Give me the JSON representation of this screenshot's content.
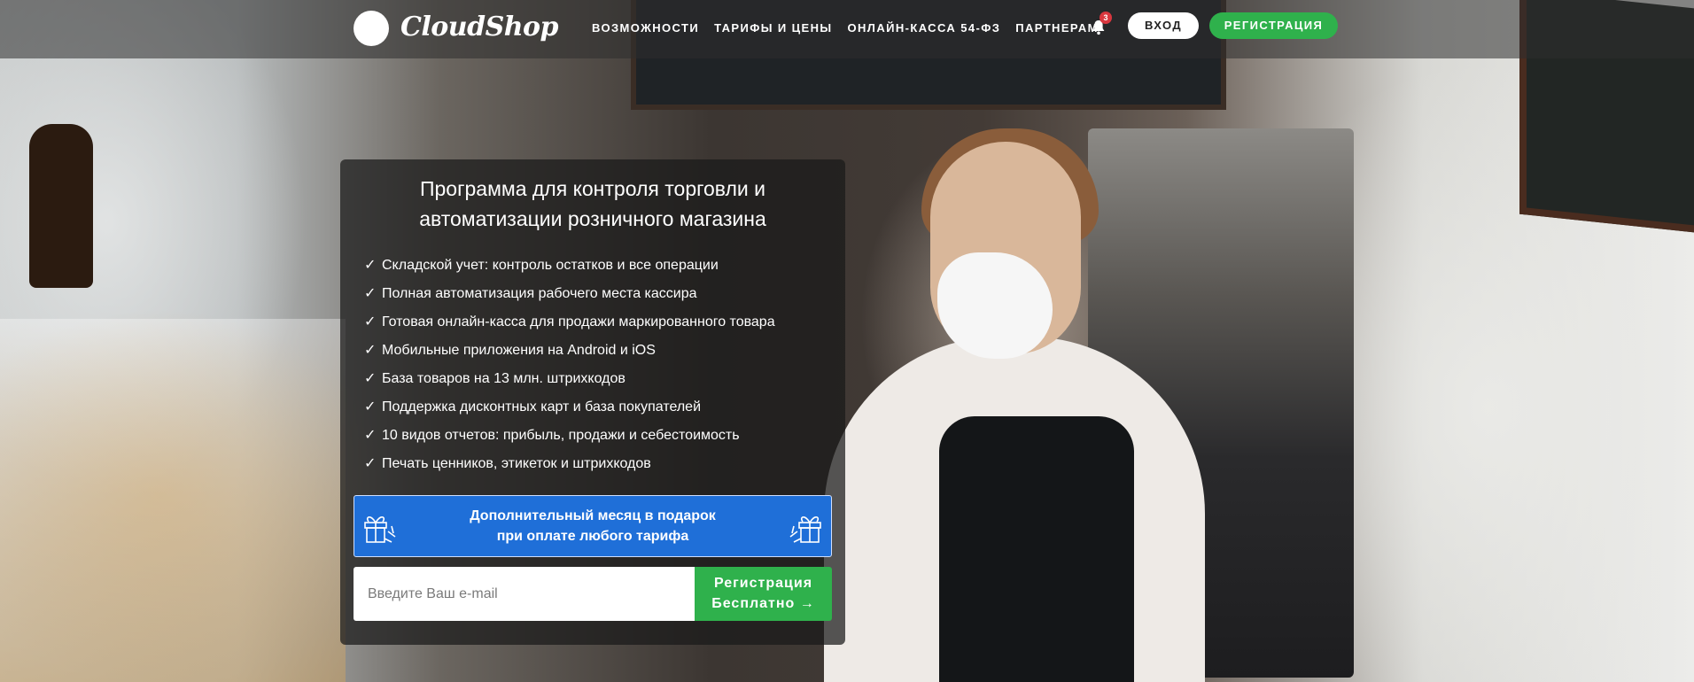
{
  "brand": {
    "name": "CloudShop"
  },
  "nav": {
    "items": [
      {
        "label": "ВОЗМОЖНОСТИ"
      },
      {
        "label": "ТАРИФЫ И ЦЕНЫ"
      },
      {
        "label": "ОНЛАЙН-КАССА 54-ФЗ"
      },
      {
        "label": "ПАРТНЕРАМ"
      }
    ],
    "notifications_count": "3",
    "login_label": "ВХОД",
    "register_label": "РЕГИСТРАЦИЯ"
  },
  "hero": {
    "title_line1": "Программа для контроля торговли и",
    "title_line2": "автоматизации розничного магазина",
    "check_symbol": "✓",
    "features": [
      "Складской учет: контроль остатков и все операции",
      "Полная автоматизация рабочего места кассира",
      "Готовая онлайн-касса для продажи маркированного товара",
      "Мобильные приложения на Android и iOS",
      "База товаров на 13 млн. штрихкодов",
      "Поддержка дисконтных карт и база покупателей",
      "10 видов отчетов: прибыль, продажи и себестоимость",
      "Печать ценников, этикеток и штрихкодов"
    ],
    "promo_line1": "Дополнительный месяц в подарок",
    "promo_line2": "при оплате любого тарифа",
    "email_placeholder": "Введите Ваш e-mail",
    "submit_line1": "Регистрация",
    "submit_line2": "Бесплатно →"
  },
  "colors": {
    "accent_green": "#2fb14c",
    "promo_blue": "#1f6fd8",
    "badge_red": "#d9373f"
  },
  "icons": [
    "bell-icon",
    "gift-icon",
    "check-icon"
  ]
}
